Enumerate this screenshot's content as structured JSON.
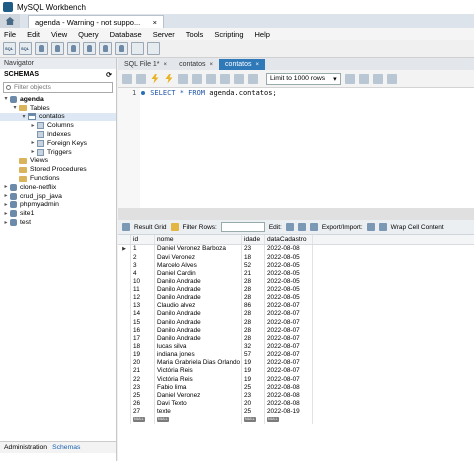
{
  "window": {
    "title": "MySQL Workbench"
  },
  "connection_tab": {
    "label": "agenda - Warning - not suppo...",
    "close": "×"
  },
  "menu": [
    "File",
    "Edit",
    "View",
    "Query",
    "Database",
    "Server",
    "Tools",
    "Scripting",
    "Help"
  ],
  "navigator": {
    "title": "Navigator",
    "schemas_label": "SCHEMAS",
    "filter_placeholder": "Filter objects",
    "tree": [
      {
        "label": "agenda",
        "level": 0,
        "icon": "database-icon",
        "twisty": "▾",
        "bold": true
      },
      {
        "label": "Tables",
        "level": 1,
        "icon": "folder-icon",
        "twisty": "▾"
      },
      {
        "label": "contatos",
        "level": 2,
        "icon": "table-icon",
        "twisty": "▾",
        "selected": true
      },
      {
        "label": "Columns",
        "level": 3,
        "icon": "columns-icon",
        "twisty": "▸"
      },
      {
        "label": "Indexes",
        "level": 3,
        "icon": "indexes-icon",
        "twisty": ""
      },
      {
        "label": "Foreign Keys",
        "level": 3,
        "icon": "foreign-keys-icon",
        "twisty": "▸"
      },
      {
        "label": "Triggers",
        "level": 3,
        "icon": "triggers-icon",
        "twisty": "▸"
      },
      {
        "label": "Views",
        "level": 1,
        "icon": "folder-icon",
        "twisty": ""
      },
      {
        "label": "Stored Procedures",
        "level": 1,
        "icon": "folder-icon",
        "twisty": ""
      },
      {
        "label": "Functions",
        "level": 1,
        "icon": "folder-icon",
        "twisty": ""
      },
      {
        "label": "clone-netflix",
        "level": 0,
        "icon": "database-icon",
        "twisty": "▸"
      },
      {
        "label": "crud_jsp_java",
        "level": 0,
        "icon": "database-icon",
        "twisty": "▸"
      },
      {
        "label": "phpmyadmin",
        "level": 0,
        "icon": "database-icon",
        "twisty": "▸"
      },
      {
        "label": "site1",
        "level": 0,
        "icon": "database-icon",
        "twisty": "▸"
      },
      {
        "label": "test",
        "level": 0,
        "icon": "database-icon",
        "twisty": "▸"
      }
    ],
    "footer_tabs": [
      "Administration",
      "Schemas"
    ]
  },
  "editor_tabs": [
    {
      "label": "SQL File 1*",
      "active": false
    },
    {
      "label": "contatos",
      "active": false
    },
    {
      "label": "contatos",
      "active": true
    }
  ],
  "editor_toolbar": {
    "limit": "Limit to 1000 rows"
  },
  "editor": {
    "line_number": "1",
    "code_keyword": "SELECT * FROM",
    "code_rest": "agenda.contatos;"
  },
  "result_toolbar": {
    "result_grid": "Result Grid",
    "filter_rows": "Filter Rows:",
    "edit": "Edit:",
    "export_import": "Export/Import:",
    "wrap": "Wrap Cell Content"
  },
  "grid": {
    "columns": [
      "id",
      "nome",
      "idade",
      "dataCadastro"
    ],
    "rows": [
      [
        "1",
        "Daniel Veronez Barboza",
        "23",
        "2022-08-08"
      ],
      [
        "2",
        "Davi Veronez",
        "18",
        "2022-08-05"
      ],
      [
        "3",
        "Marcelo Alves",
        "52",
        "2022-08-05"
      ],
      [
        "4",
        "Daniel Cardin",
        "21",
        "2022-08-05"
      ],
      [
        "10",
        "Danilo Andrade",
        "28",
        "2022-08-05"
      ],
      [
        "11",
        "Danilo Andrade",
        "28",
        "2022-08-05"
      ],
      [
        "12",
        "Danilo Andrade",
        "28",
        "2022-08-05"
      ],
      [
        "13",
        "Claudio alvez",
        "86",
        "2022-08-07"
      ],
      [
        "14",
        "Danilo Andrade",
        "28",
        "2022-08-07"
      ],
      [
        "15",
        "Danilo Andrade",
        "28",
        "2022-08-07"
      ],
      [
        "16",
        "Danilo Andrade",
        "28",
        "2022-08-07"
      ],
      [
        "17",
        "Danilo Andrade",
        "28",
        "2022-08-07"
      ],
      [
        "18",
        "lucas silva",
        "32",
        "2022-08-07"
      ],
      [
        "19",
        "indiana jones",
        "57",
        "2022-08-07"
      ],
      [
        "20",
        "Maria Grabriela Dias Orlando",
        "19",
        "2022-08-07"
      ],
      [
        "21",
        "Victória Reis",
        "19",
        "2022-08-07"
      ],
      [
        "22",
        "Victória Reis",
        "19",
        "2022-08-07"
      ],
      [
        "23",
        "Fabio lima",
        "25",
        "2022-08-08"
      ],
      [
        "25",
        "Daniel Veronez",
        "23",
        "2022-08-08"
      ],
      [
        "26",
        "Davi Texto",
        "20",
        "2022-08-08"
      ],
      [
        "27",
        "texte",
        "25",
        "2022-08-19"
      ]
    ],
    "null_label": "NULL",
    "current_row_marker": "▶"
  }
}
